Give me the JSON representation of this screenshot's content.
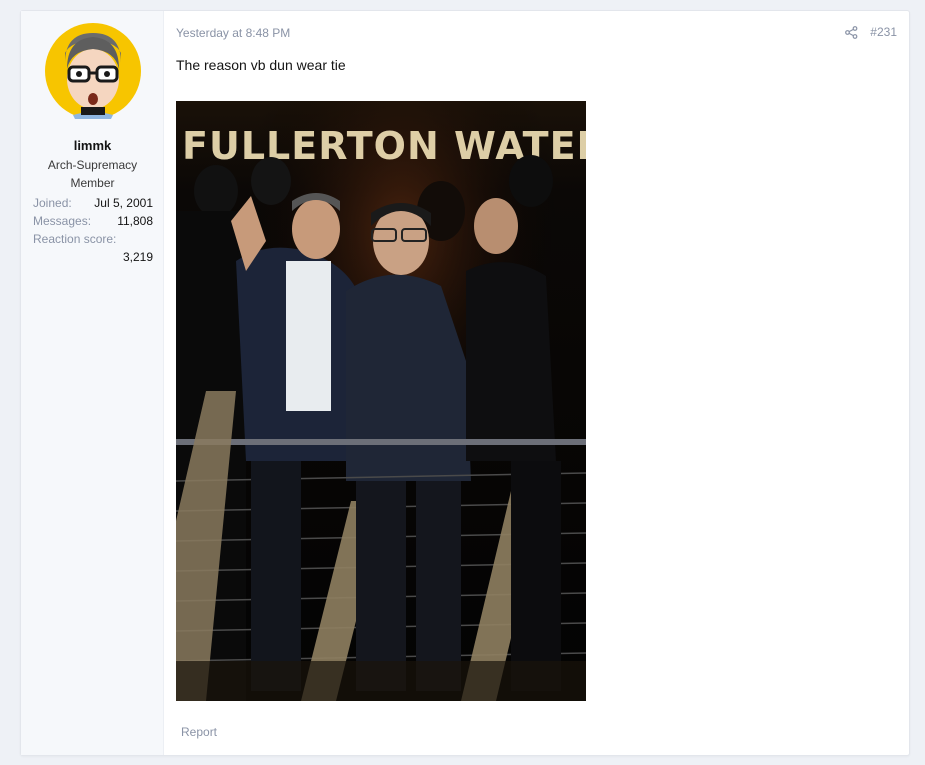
{
  "post": {
    "timestamp": "Yesterday at 8:48 PM",
    "post_number": "#231",
    "body_text": "The reason vb dun wear tie",
    "image_sign_text": "FULLERTON WATERBOAT HOU",
    "report_label": "Report"
  },
  "user": {
    "username": "limmk",
    "title": "Arch-Supremacy Member",
    "stats": [
      {
        "label": "Joined:",
        "value": "Jul 5, 2001"
      },
      {
        "label": "Messages:",
        "value": "11,808"
      },
      {
        "label": "Reaction score:",
        "value": "3,219"
      }
    ]
  },
  "icons": {
    "share": "share-icon",
    "avatar": "avatar-icon"
  },
  "colors": {
    "page_bg": "#eef1f6",
    "card_bg": "#ffffff",
    "muted_text": "#8a93a6",
    "avatar_bg": "#f7c500"
  }
}
